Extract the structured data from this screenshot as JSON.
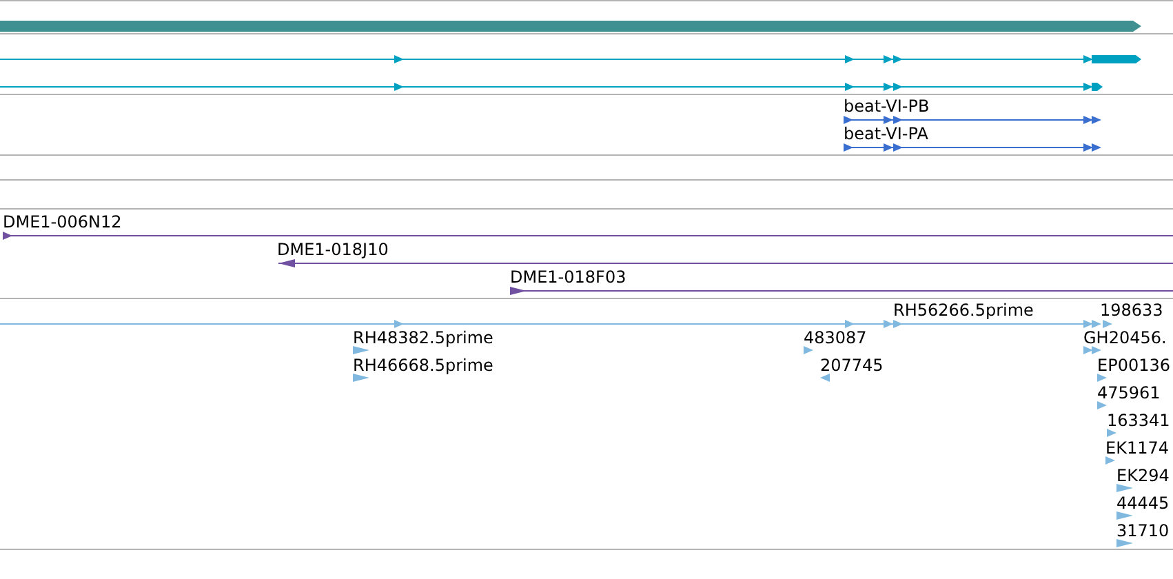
{
  "tracks": [
    {
      "kind": "gene",
      "color": "#3f9090",
      "features": [
        {
          "reverse": false
        }
      ]
    },
    {
      "kind": "transcript",
      "color": "#00a0c0",
      "features": [
        {
          "reverse": false
        },
        {
          "reverse": false
        }
      ]
    },
    {
      "kind": "transcript",
      "color": "#3a6fd0",
      "features": [
        {
          "label": "beat-VI-PB",
          "reverse": false
        },
        {
          "label": "beat-VI-PA",
          "reverse": false
        }
      ]
    },
    {
      "kind": "empty"
    },
    {
      "kind": "empty"
    },
    {
      "kind": "clone",
      "color": "#7050a0",
      "features": [
        {
          "label": "DME1-006N12",
          "reverse": false
        },
        {
          "label": "DME1-018J10",
          "reverse": true
        },
        {
          "label": "DME1-018F03",
          "reverse": false
        }
      ]
    },
    {
      "kind": "est",
      "color": "#80b8e0",
      "features": [
        {
          "label": "RH56266.5prime",
          "reverse": false
        },
        {
          "label": "198633",
          "reverse": false
        },
        {
          "label": "RH48382.5prime",
          "reverse": false
        },
        {
          "label": "RH46668.5prime",
          "reverse": false
        },
        {
          "label": "483087",
          "reverse": false
        },
        {
          "label": "207745",
          "reverse": true
        },
        {
          "label": "GH20456.",
          "reverse": false
        },
        {
          "label": "EP00136",
          "reverse": false
        },
        {
          "label": "475961",
          "reverse": false
        },
        {
          "label": "163341",
          "reverse": false
        },
        {
          "label": "EK1174",
          "reverse": false
        },
        {
          "label": "EK294",
          "reverse": false
        },
        {
          "label": "44445",
          "reverse": false
        },
        {
          "label": "31710",
          "reverse": false
        }
      ]
    }
  ]
}
